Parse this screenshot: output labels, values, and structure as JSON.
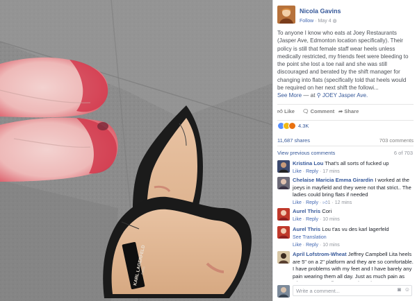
{
  "post": {
    "author": "Nicola Gavins",
    "follow_label": "Follow",
    "date": "May 4",
    "text": "To anyone I know who eats at Joey Restaurants (Jasper Ave, Edmonton location specifically). Their policy is still that female staff wear heels unless medically restricted, my friends feet were bleeding to the point she lost a toe nail and she was still discouraged and berated by the shift manager for changing into flats (specifically told that heels would be required on her next shift the followi...",
    "see_more": "See More",
    "at_text": "— at",
    "location": "JOEY Jasper Ave."
  },
  "photo": {
    "shoe_brand": "KARL LAGERFELD",
    "shoe_sub": "PARIS"
  },
  "actions": {
    "like": "Like",
    "comment": "Comment",
    "share": "Share"
  },
  "reactions": {
    "count": "4.3K",
    "colors": [
      "#5890ff",
      "#f0ba15",
      "#e9710f"
    ]
  },
  "stats": {
    "shares": "11,687 shares",
    "comments": "703 comments"
  },
  "comments_section": {
    "view_previous": "View previous comments",
    "count": "6 of 703",
    "comments": [
      {
        "name": "Kristina Lou",
        "text": "That's all sorts of fucked up",
        "meta": [
          "Like",
          "Reply",
          "17 mins"
        ]
      },
      {
        "name": "Chelaise Maricia Emma Girardin",
        "text": "I worked at the joeys in mayfield and they were not that strict.. The ladies could bring flats if needed",
        "meta": [
          "Like",
          "Reply",
          "1",
          "12 mins"
        ]
      },
      {
        "name": "Aurel Thris",
        "text": "Cori",
        "meta": [
          "Like",
          "Reply",
          "10 mins"
        ]
      },
      {
        "name": "Aurel Thris",
        "text": "Lou t'as vu des karl lagerfeld",
        "see_translation": "See Translation",
        "meta": [
          "Like",
          "Reply",
          "10 mins"
        ]
      },
      {
        "name": "April Lofstrom-Wheat",
        "text": "Jeffrey Campbell Lita heels are 5\" on a 2\" platform and they are so comfortable. I have problems with my feet and I have barely any pain wearing them all day. Just as much pain as when I wear my flats, sometimes less"
      }
    ],
    "write_placeholder": "Write a comment..."
  }
}
